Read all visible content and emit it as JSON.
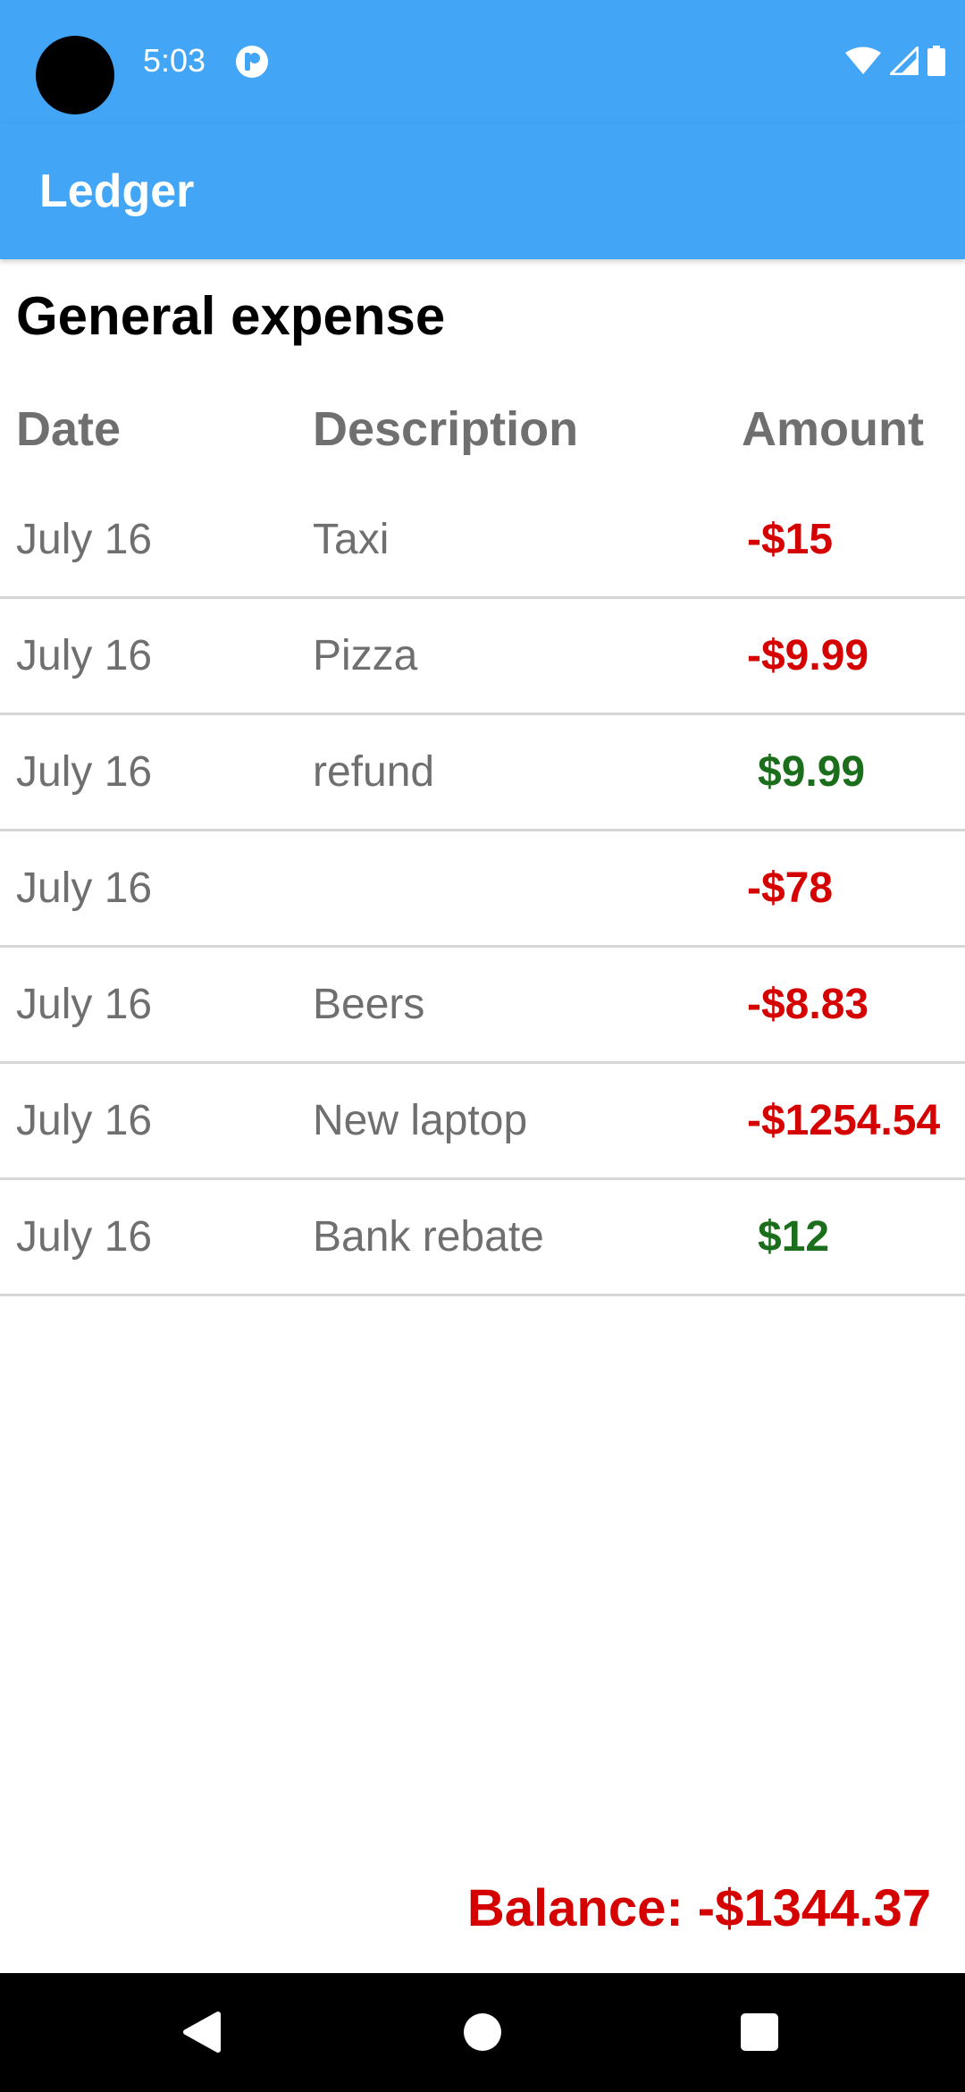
{
  "status_bar": {
    "time": "5:03",
    "icons": [
      "camera-cutout",
      "notification-app-icon",
      "wifi-icon",
      "signal-icon",
      "battery-icon"
    ]
  },
  "app_bar": {
    "title": "Ledger"
  },
  "ledger": {
    "title": "General expense",
    "columns": {
      "date": "Date",
      "description": "Description",
      "amount": "Amount"
    },
    "rows": [
      {
        "date": "July 16",
        "description": "Taxi",
        "amount": "-$15",
        "type": "debit"
      },
      {
        "date": "July 16",
        "description": "Pizza",
        "amount": "-$9.99",
        "type": "debit"
      },
      {
        "date": "July 16",
        "description": "refund",
        "amount": "$9.99",
        "type": "credit"
      },
      {
        "date": "July 16",
        "description": "",
        "amount": "-$78",
        "type": "debit"
      },
      {
        "date": "July 16",
        "description": "Beers",
        "amount": "-$8.83",
        "type": "debit"
      },
      {
        "date": "July 16",
        "description": "New laptop",
        "amount": "-$1254.54",
        "type": "debit"
      },
      {
        "date": "July 16",
        "description": "Bank rebate",
        "amount": "$12",
        "type": "credit"
      }
    ],
    "balance": "Balance: -$1344.37"
  },
  "nav_bar": {
    "buttons": [
      "back-icon",
      "home-icon",
      "recents-icon"
    ]
  },
  "colors": {
    "primary": "#42a5f5",
    "debit": "#d50000",
    "credit": "#1b6e1b",
    "muted_text": "#6f6f6f",
    "divider": "#d6d6d6"
  }
}
